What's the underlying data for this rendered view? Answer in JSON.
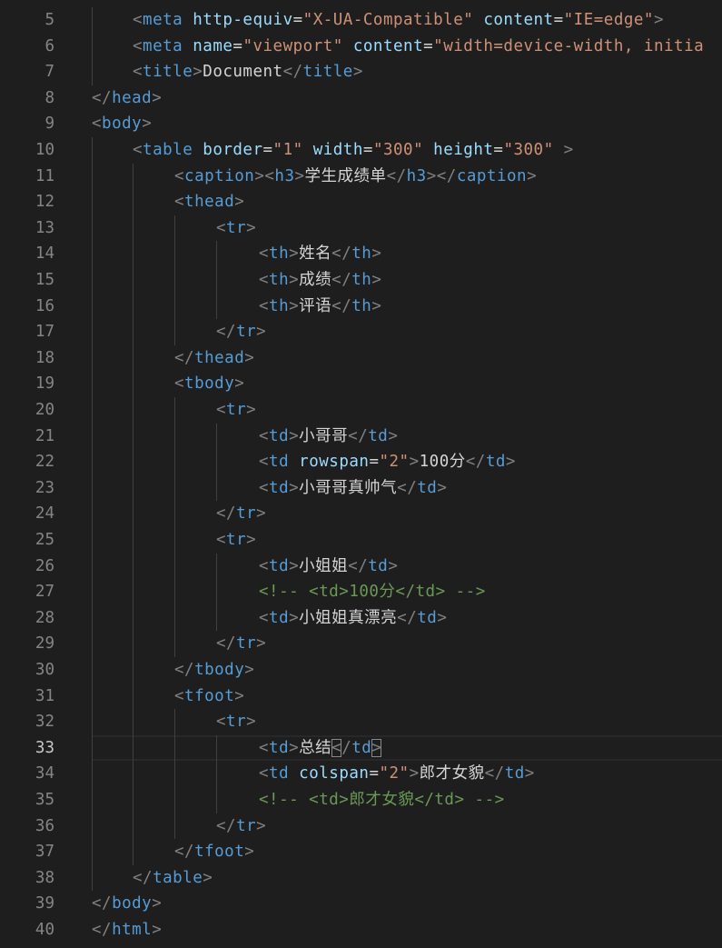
{
  "editor": {
    "language": "html",
    "current_line": 33,
    "colors": {
      "background": "#1e1e1e",
      "tag": "#569cd6",
      "attribute": "#9cdcfe",
      "string": "#ce9178",
      "comment": "#6a9955",
      "punctuation": "#808080",
      "text": "#d4d4d4",
      "line_number": "#858585"
    },
    "lines": [
      {
        "n": "5",
        "indent": 2,
        "tokens": [
          [
            "punct",
            "<"
          ],
          [
            "tag",
            "meta"
          ],
          [
            "text",
            " "
          ],
          [
            "attr",
            "http-equiv"
          ],
          [
            "equals",
            "="
          ],
          [
            "str",
            "\"X-UA-Compatible\""
          ],
          [
            "text",
            " "
          ],
          [
            "attr",
            "content"
          ],
          [
            "equals",
            "="
          ],
          [
            "str",
            "\"IE=edge\""
          ],
          [
            "punct",
            ">"
          ]
        ]
      },
      {
        "n": "6",
        "indent": 2,
        "tokens": [
          [
            "punct",
            "<"
          ],
          [
            "tag",
            "meta"
          ],
          [
            "text",
            " "
          ],
          [
            "attr",
            "name"
          ],
          [
            "equals",
            "="
          ],
          [
            "str",
            "\"viewport\""
          ],
          [
            "text",
            " "
          ],
          [
            "attr",
            "content"
          ],
          [
            "equals",
            "="
          ],
          [
            "str",
            "\"width=device-width, initia"
          ]
        ]
      },
      {
        "n": "7",
        "indent": 2,
        "tokens": [
          [
            "punct",
            "<"
          ],
          [
            "tag",
            "title"
          ],
          [
            "punct",
            ">"
          ],
          [
            "text",
            "Document"
          ],
          [
            "punct",
            "</"
          ],
          [
            "tag",
            "title"
          ],
          [
            "punct",
            ">"
          ]
        ]
      },
      {
        "n": "8",
        "indent": 1,
        "tokens": [
          [
            "punct",
            "</"
          ],
          [
            "tag",
            "head"
          ],
          [
            "punct",
            ">"
          ]
        ]
      },
      {
        "n": "9",
        "indent": 1,
        "tokens": [
          [
            "punct",
            "<"
          ],
          [
            "tag",
            "body"
          ],
          [
            "punct",
            ">"
          ]
        ]
      },
      {
        "n": "10",
        "indent": 2,
        "tokens": [
          [
            "punct",
            "<"
          ],
          [
            "tag",
            "table"
          ],
          [
            "text",
            " "
          ],
          [
            "attr",
            "border"
          ],
          [
            "equals",
            "="
          ],
          [
            "str",
            "\"1\""
          ],
          [
            "text",
            " "
          ],
          [
            "attr",
            "width"
          ],
          [
            "equals",
            "="
          ],
          [
            "str",
            "\"300\""
          ],
          [
            "text",
            " "
          ],
          [
            "attr",
            "height"
          ],
          [
            "equals",
            "="
          ],
          [
            "str",
            "\"300\""
          ],
          [
            "text",
            " "
          ],
          [
            "punct",
            ">"
          ]
        ]
      },
      {
        "n": "11",
        "indent": 3,
        "tokens": [
          [
            "punct",
            "<"
          ],
          [
            "tag",
            "caption"
          ],
          [
            "punct",
            ">"
          ],
          [
            "punct",
            "<"
          ],
          [
            "tag",
            "h3"
          ],
          [
            "punct",
            ">"
          ],
          [
            "text",
            "学生成绩单"
          ],
          [
            "punct",
            "</"
          ],
          [
            "tag",
            "h3"
          ],
          [
            "punct",
            ">"
          ],
          [
            "punct",
            "</"
          ],
          [
            "tag",
            "caption"
          ],
          [
            "punct",
            ">"
          ]
        ]
      },
      {
        "n": "12",
        "indent": 3,
        "tokens": [
          [
            "punct",
            "<"
          ],
          [
            "tag",
            "thead"
          ],
          [
            "punct",
            ">"
          ]
        ]
      },
      {
        "n": "13",
        "indent": 4,
        "tokens": [
          [
            "punct",
            "<"
          ],
          [
            "tag",
            "tr"
          ],
          [
            "punct",
            ">"
          ]
        ]
      },
      {
        "n": "14",
        "indent": 5,
        "tokens": [
          [
            "punct",
            "<"
          ],
          [
            "tag",
            "th"
          ],
          [
            "punct",
            ">"
          ],
          [
            "text",
            "姓名"
          ],
          [
            "punct",
            "</"
          ],
          [
            "tag",
            "th"
          ],
          [
            "punct",
            ">"
          ]
        ]
      },
      {
        "n": "15",
        "indent": 5,
        "tokens": [
          [
            "punct",
            "<"
          ],
          [
            "tag",
            "th"
          ],
          [
            "punct",
            ">"
          ],
          [
            "text",
            "成绩"
          ],
          [
            "punct",
            "</"
          ],
          [
            "tag",
            "th"
          ],
          [
            "punct",
            ">"
          ]
        ]
      },
      {
        "n": "16",
        "indent": 5,
        "tokens": [
          [
            "punct",
            "<"
          ],
          [
            "tag",
            "th"
          ],
          [
            "punct",
            ">"
          ],
          [
            "text",
            "评语"
          ],
          [
            "punct",
            "</"
          ],
          [
            "tag",
            "th"
          ],
          [
            "punct",
            ">"
          ]
        ]
      },
      {
        "n": "17",
        "indent": 4,
        "tokens": [
          [
            "punct",
            "</"
          ],
          [
            "tag",
            "tr"
          ],
          [
            "punct",
            ">"
          ]
        ]
      },
      {
        "n": "18",
        "indent": 3,
        "tokens": [
          [
            "punct",
            "</"
          ],
          [
            "tag",
            "thead"
          ],
          [
            "punct",
            ">"
          ]
        ]
      },
      {
        "n": "19",
        "indent": 3,
        "tokens": [
          [
            "punct",
            "<"
          ],
          [
            "tag",
            "tbody"
          ],
          [
            "punct",
            ">"
          ]
        ]
      },
      {
        "n": "20",
        "indent": 4,
        "tokens": [
          [
            "punct",
            "<"
          ],
          [
            "tag",
            "tr"
          ],
          [
            "punct",
            ">"
          ]
        ]
      },
      {
        "n": "21",
        "indent": 5,
        "tokens": [
          [
            "punct",
            "<"
          ],
          [
            "tag",
            "td"
          ],
          [
            "punct",
            ">"
          ],
          [
            "text",
            "小哥哥"
          ],
          [
            "punct",
            "</"
          ],
          [
            "tag",
            "td"
          ],
          [
            "punct",
            ">"
          ]
        ]
      },
      {
        "n": "22",
        "indent": 5,
        "tokens": [
          [
            "punct",
            "<"
          ],
          [
            "tag",
            "td"
          ],
          [
            "text",
            " "
          ],
          [
            "attr",
            "rowspan"
          ],
          [
            "equals",
            "="
          ],
          [
            "str",
            "\"2\""
          ],
          [
            "punct",
            ">"
          ],
          [
            "text",
            "100分"
          ],
          [
            "punct",
            "</"
          ],
          [
            "tag",
            "td"
          ],
          [
            "punct",
            ">"
          ]
        ]
      },
      {
        "n": "23",
        "indent": 5,
        "tokens": [
          [
            "punct",
            "<"
          ],
          [
            "tag",
            "td"
          ],
          [
            "punct",
            ">"
          ],
          [
            "text",
            "小哥哥真帅气"
          ],
          [
            "punct",
            "</"
          ],
          [
            "tag",
            "td"
          ],
          [
            "punct",
            ">"
          ]
        ]
      },
      {
        "n": "24",
        "indent": 4,
        "tokens": [
          [
            "punct",
            "</"
          ],
          [
            "tag",
            "tr"
          ],
          [
            "punct",
            ">"
          ]
        ]
      },
      {
        "n": "25",
        "indent": 4,
        "tokens": [
          [
            "punct",
            "<"
          ],
          [
            "tag",
            "tr"
          ],
          [
            "punct",
            ">"
          ]
        ]
      },
      {
        "n": "26",
        "indent": 5,
        "tokens": [
          [
            "punct",
            "<"
          ],
          [
            "tag",
            "td"
          ],
          [
            "punct",
            ">"
          ],
          [
            "text",
            "小姐姐"
          ],
          [
            "punct",
            "</"
          ],
          [
            "tag",
            "td"
          ],
          [
            "punct",
            ">"
          ]
        ]
      },
      {
        "n": "27",
        "indent": 5,
        "tokens": [
          [
            "comment",
            "<!-- <td>100分</td> -->"
          ]
        ]
      },
      {
        "n": "28",
        "indent": 5,
        "tokens": [
          [
            "punct",
            "<"
          ],
          [
            "tag",
            "td"
          ],
          [
            "punct",
            ">"
          ],
          [
            "text",
            "小姐姐真漂亮"
          ],
          [
            "punct",
            "</"
          ],
          [
            "tag",
            "td"
          ],
          [
            "punct",
            ">"
          ]
        ]
      },
      {
        "n": "29",
        "indent": 4,
        "tokens": [
          [
            "punct",
            "</"
          ],
          [
            "tag",
            "tr"
          ],
          [
            "punct",
            ">"
          ]
        ]
      },
      {
        "n": "30",
        "indent": 3,
        "tokens": [
          [
            "punct",
            "</"
          ],
          [
            "tag",
            "tbody"
          ],
          [
            "punct",
            ">"
          ]
        ]
      },
      {
        "n": "31",
        "indent": 3,
        "tokens": [
          [
            "punct",
            "<"
          ],
          [
            "tag",
            "tfoot"
          ],
          [
            "punct",
            ">"
          ]
        ]
      },
      {
        "n": "32",
        "indent": 4,
        "tokens": [
          [
            "punct",
            "<"
          ],
          [
            "tag",
            "tr"
          ],
          [
            "punct",
            ">"
          ]
        ]
      },
      {
        "n": "33",
        "indent": 5,
        "tokens": [
          [
            "punct",
            "<"
          ],
          [
            "tag",
            "td"
          ],
          [
            "punct",
            ">"
          ],
          [
            "text",
            "总结"
          ],
          [
            "bracket",
            "<"
          ],
          [
            "punct",
            "/"
          ],
          [
            "tag",
            "td"
          ],
          [
            "bracket",
            ">"
          ]
        ]
      },
      {
        "n": "34",
        "indent": 5,
        "tokens": [
          [
            "punct",
            "<"
          ],
          [
            "tag",
            "td"
          ],
          [
            "text",
            " "
          ],
          [
            "attr",
            "colspan"
          ],
          [
            "equals",
            "="
          ],
          [
            "str",
            "\"2\""
          ],
          [
            "punct",
            ">"
          ],
          [
            "text",
            "郎才女貌"
          ],
          [
            "punct",
            "</"
          ],
          [
            "tag",
            "td"
          ],
          [
            "punct",
            ">"
          ]
        ]
      },
      {
        "n": "35",
        "indent": 5,
        "tokens": [
          [
            "comment",
            "<!-- <td>郎才女貌</td> -->"
          ]
        ]
      },
      {
        "n": "36",
        "indent": 4,
        "tokens": [
          [
            "punct",
            "</"
          ],
          [
            "tag",
            "tr"
          ],
          [
            "punct",
            ">"
          ]
        ]
      },
      {
        "n": "37",
        "indent": 3,
        "tokens": [
          [
            "punct",
            "</"
          ],
          [
            "tag",
            "tfoot"
          ],
          [
            "punct",
            ">"
          ]
        ]
      },
      {
        "n": "38",
        "indent": 2,
        "tokens": [
          [
            "punct",
            "</"
          ],
          [
            "tag",
            "table"
          ],
          [
            "punct",
            ">"
          ]
        ]
      },
      {
        "n": "39",
        "indent": 1,
        "tokens": [
          [
            "punct",
            "</"
          ],
          [
            "tag",
            "body"
          ],
          [
            "punct",
            ">"
          ]
        ]
      },
      {
        "n": "40",
        "indent": 1,
        "tokens": [
          [
            "punct",
            "</"
          ],
          [
            "tag",
            "html"
          ],
          [
            "punct",
            ">"
          ]
        ]
      }
    ]
  }
}
